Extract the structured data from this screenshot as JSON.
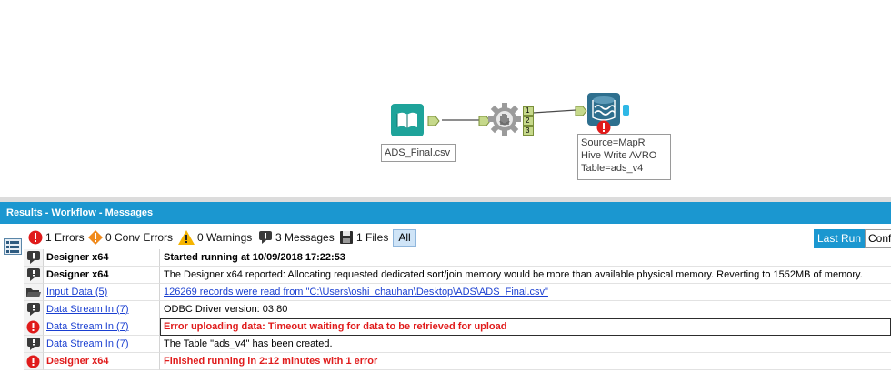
{
  "canvas": {
    "input_tool_label": "ADS_Final.csv",
    "anchor_labels": [
      "1",
      "2",
      "3"
    ],
    "output_annotation": [
      "Source=MapR",
      "Hive Write AVRO",
      "Table=ads_v4"
    ],
    "colors": {
      "input_tool": "#1ea39a",
      "connection_anchor": "#c6d98b",
      "output_tool": "#2e6f8e",
      "error": "#e01b1b"
    }
  },
  "results": {
    "header": "Results - Workflow - Messages"
  },
  "toolbar": {
    "filters": [
      {
        "icon": "error-icon",
        "label": "1 Errors"
      },
      {
        "icon": "conv-error-icon",
        "label": "0 Conv Errors"
      },
      {
        "icon": "warning-icon",
        "label": "0 Warnings"
      },
      {
        "icon": "message-icon",
        "label": "3 Messages"
      },
      {
        "icon": "file-icon",
        "label": "1 Files"
      }
    ],
    "all_label": "All",
    "last_run_label": "Last Run",
    "conf_label": "Conf"
  },
  "messages": [
    {
      "icon": "message-icon",
      "source": "Designer x64",
      "source_style": "bold",
      "text": "Started running at 10/09/2018 17:22:53",
      "text_style": "bold"
    },
    {
      "icon": "message-icon",
      "source": "Designer x64",
      "source_style": "bold",
      "text": "The Designer x64 reported: Allocating requested dedicated sort/join memory would be more than available physical memory.  Reverting to 1552MB of memory.",
      "text_style": "normal"
    },
    {
      "icon": "folder-icon",
      "source": "Input Data (5)",
      "source_style": "link",
      "text": "126269 records were read from \"C:\\Users\\oshi_chauhan\\Desktop\\ADS\\ADS_Final.csv\"",
      "text_style": "link"
    },
    {
      "icon": "message-icon",
      "source": "Data Stream In (7)",
      "source_style": "link",
      "text": "ODBC Driver version: 03.80",
      "text_style": "normal"
    },
    {
      "icon": "error-icon",
      "source": "Data Stream In (7)",
      "source_style": "link",
      "text": "Error uploading data: Timeout waiting for data to be retrieved for upload",
      "text_style": "error"
    },
    {
      "icon": "message-icon",
      "source": "Data Stream In (7)",
      "source_style": "link",
      "text": "The Table \"ads_v4\" has been created.",
      "text_style": "normal"
    },
    {
      "icon": "error-icon",
      "source": "Designer x64",
      "source_style": "error",
      "text": "Finished running in 2:12 minutes with 1 error",
      "text_style": "error"
    }
  ]
}
